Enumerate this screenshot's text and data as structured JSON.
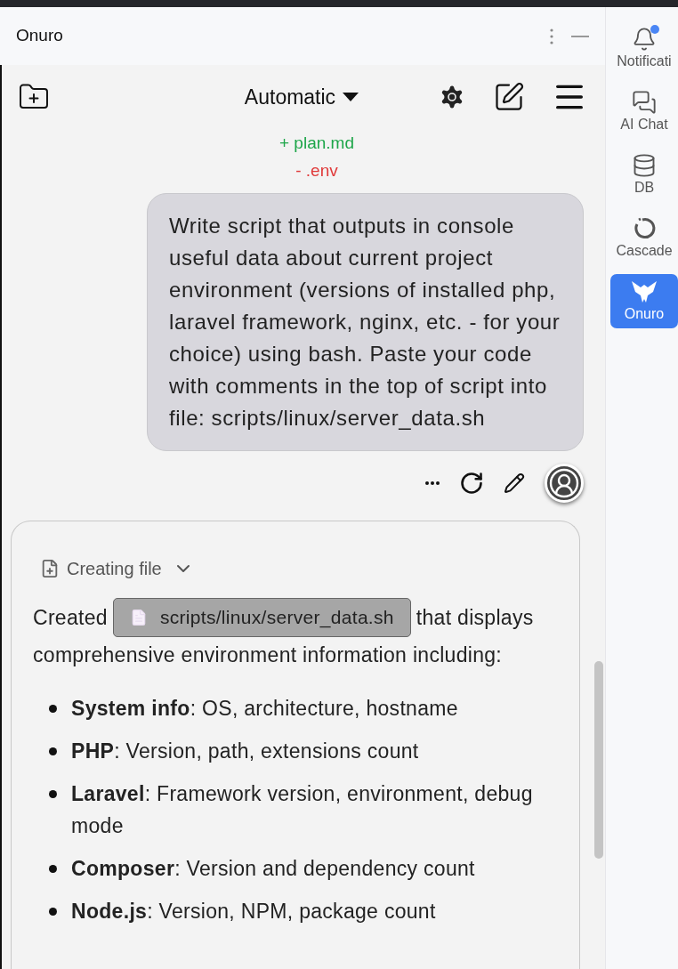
{
  "window": {
    "title": "Onuro"
  },
  "toolbar": {
    "mode": "Automatic"
  },
  "file_changes": [
    {
      "kind": "added",
      "text": "+ plan.md"
    },
    {
      "kind": "removed",
      "text": "- .env"
    }
  ],
  "user_message": {
    "text": "Write script that outputs in console useful data about current project environment (versions of installed php, laravel framework, nginx, etc. - for your choice) using bash. Paste your code with comments in the top of script into file: scripts/linux/server_data.sh"
  },
  "assistant_message": {
    "step": {
      "label": "Creating file",
      "expanded": false
    },
    "text_before": "Created",
    "file_chip": "scripts/linux/server_data.sh",
    "text_after": "that displays",
    "text_continued": "comprehensive environment information including:",
    "items": [
      "**System info**: OS, architecture, hostname",
      "**PHP**: Version, path, extensions count",
      "**Laravel**: Framework version, environment, debug mode",
      "**Composer**: Version and dependency count",
      "**Node.js**: Version, NPM, package count"
    ]
  },
  "sidebar": {
    "items": [
      {
        "kind": "notifications",
        "label": "Notificati",
        "selected": false,
        "has_notification": true
      },
      {
        "kind": "ai-chat",
        "label": "AI Chat",
        "selected": false,
        "has_notification": false
      },
      {
        "kind": "db",
        "label": "DB",
        "selected": false,
        "has_notification": false
      },
      {
        "kind": "cascade",
        "label": "Cascade",
        "selected": false,
        "has_notification": false
      },
      {
        "kind": "onuro",
        "label": "Onuro",
        "selected": true,
        "has_notification": false
      }
    ]
  }
}
